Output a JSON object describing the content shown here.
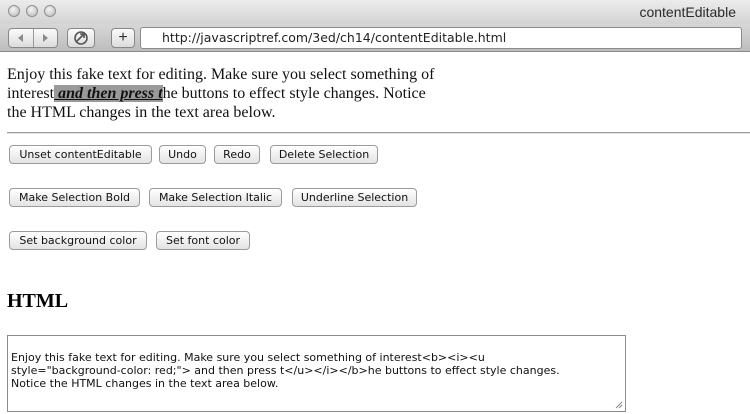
{
  "window": {
    "title": "contentEditable"
  },
  "toolbar": {
    "back_icon": "back-arrow-icon",
    "forward_icon": "forward-arrow-icon",
    "action_icon": "share-action-icon",
    "new_tab_label": "+",
    "url": "http://javascriptref.com/3ed/ch14/contentEditable.html"
  },
  "editable": {
    "text_before": "Enjoy this fake text for editing. Make sure you select something of interest",
    "selected_text": " and then press t",
    "text_after": "he buttons to effect style changes. Notice the HTML changes in the text area below."
  },
  "buttons": {
    "unset": "Unset contentEditable",
    "undo": "Undo",
    "redo": "Redo",
    "delete": "Delete Selection",
    "bold": "Make Selection Bold",
    "italic": "Make Selection Italic",
    "underline": "Underline Selection",
    "bgcolor": "Set background color",
    "fontcolor": "Set font color"
  },
  "html_section": {
    "heading": "HTML",
    "textarea_value": "Enjoy this fake text for editing. Make sure you select something of interest<b><i><u\nstyle=\"background-color: red;\"> and then press t</u></i></b>he buttons to effect style changes.\nNotice the HTML changes in the text area below."
  },
  "colors": {
    "selection_highlight": "#9a9a9a",
    "chrome_gray": "#d3d3d3"
  }
}
